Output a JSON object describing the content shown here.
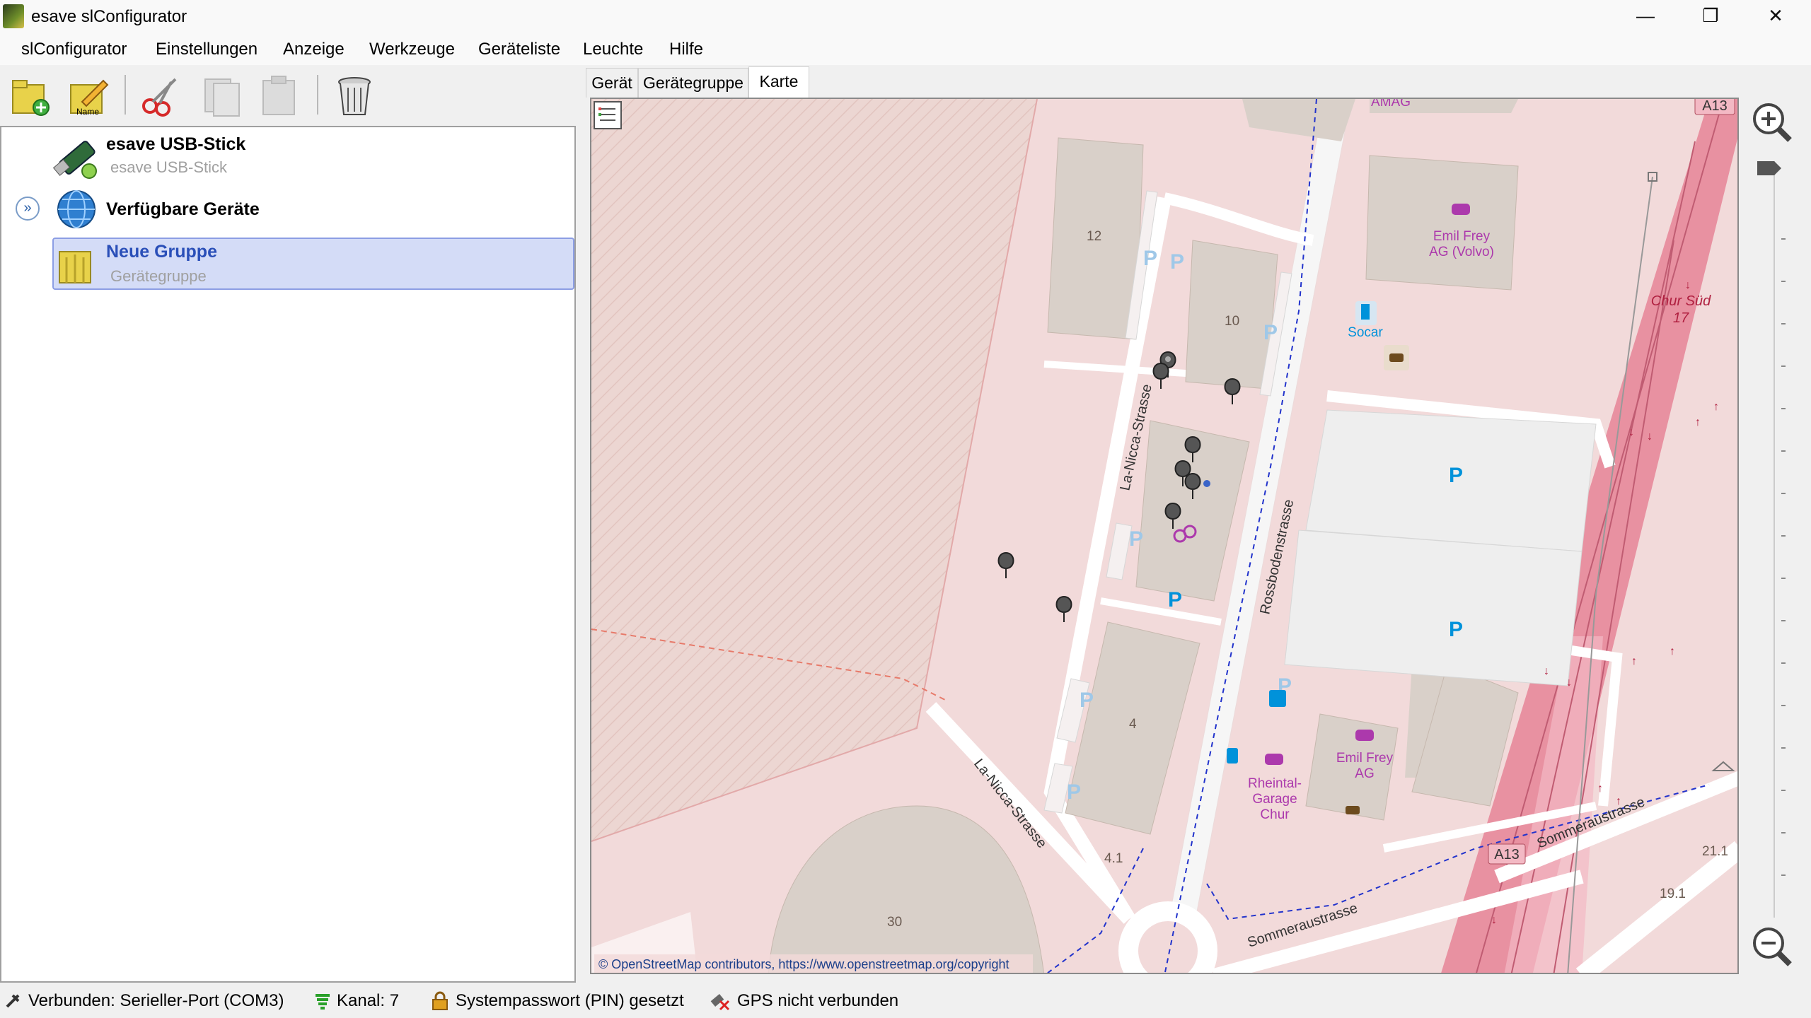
{
  "window": {
    "title": "esave slConfigurator",
    "minimize": "—",
    "maximize": "❐",
    "close": "✕"
  },
  "menu": [
    "slConfigurator",
    "Einstellungen",
    "Anzeige",
    "Werkzeuge",
    "Geräteliste",
    "Leuchte",
    "Hilfe"
  ],
  "toolbar": {
    "new_icon": "new-folder-icon",
    "rename_label": "Name",
    "cut_icon": "scissors-icon",
    "copy_icon": "copy-icon",
    "paste_icon": "paste-icon",
    "delete_icon": "trash-icon"
  },
  "tree": {
    "usb": {
      "title": "esave USB-Stick",
      "subtitle": "esave USB-Stick"
    },
    "available": {
      "title": "Verfügbare Geräte"
    },
    "group": {
      "title": "Neue Gruppe",
      "subtitle": "Gerätegruppe"
    }
  },
  "tabs": [
    {
      "label": "Gerät",
      "active": false
    },
    {
      "label": "Gerätegruppe",
      "active": false
    },
    {
      "label": "Karte",
      "active": true
    }
  ],
  "map": {
    "labels": {
      "b12": "12",
      "b10": "10",
      "b4": "4",
      "b30": "30",
      "n41": "4.1",
      "n211": "21.1",
      "n191": "19.1",
      "street1": "La-Nicca-Strasse",
      "street2": "La-Nicca-Strasse",
      "street3": "Rossbodenstrasse",
      "street4": "Sommeraustrasse",
      "street5": "Sommeraustrasse",
      "poi1": "Emil Frey",
      "poi1b": "AG (Volvo)",
      "poi2": "Socar",
      "poi3": "Emil Frey",
      "poi3b": "AG",
      "poi4": "Rheintal-",
      "poi4b": "Garage",
      "poi4c": "Chur",
      "exit": "Chur Süd",
      "exitnum": "17",
      "a13": "A13",
      "a13top": "A13",
      "amag": "AMAG",
      "copyright": "© OpenStreetMap contributors, https://www.openstreetmap.org/copyright"
    },
    "colors": {
      "bg": "#f2dada",
      "building": "#d9d0c9",
      "road": "#ffffff",
      "motorway": "#e891a1",
      "parking": "#eeeeee",
      "poi": "#ac39ac",
      "blue": "#0092da"
    }
  },
  "status": {
    "connection": "Verbunden: Serieller-Port (COM3)",
    "channel": "Kanal: 7",
    "pin": "Systempasswort (PIN) gesetzt",
    "gps": "GPS nicht verbunden"
  }
}
